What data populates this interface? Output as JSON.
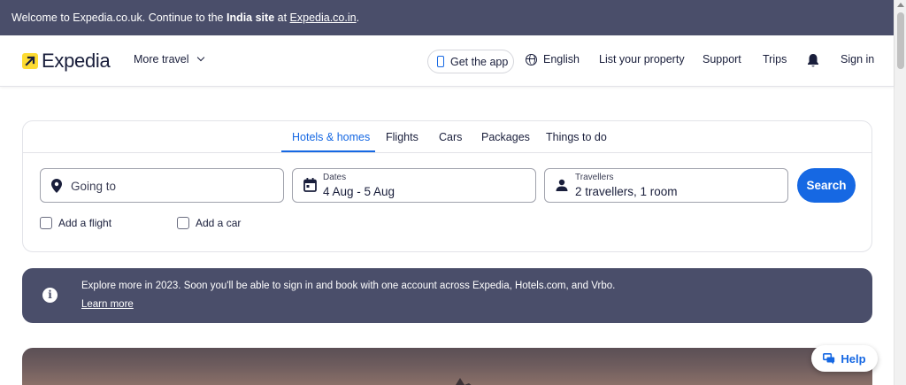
{
  "banner": {
    "prefix": "Welcome to Expedia.co.uk. Continue to the ",
    "bold": "India site",
    "middle": " at ",
    "link": "Expedia.co.in",
    "suffix": "."
  },
  "header": {
    "logo_text": "Expedia",
    "more_travel": "More travel",
    "get_app": "Get the app",
    "language": "English",
    "list_property": "List your property",
    "support": "Support",
    "trips": "Trips",
    "sign_in": "Sign in"
  },
  "search": {
    "tabs": [
      {
        "label": "Hotels & homes",
        "active": true
      },
      {
        "label": "Flights",
        "active": false
      },
      {
        "label": "Cars",
        "active": false
      },
      {
        "label": "Packages",
        "active": false
      },
      {
        "label": "Things to do",
        "active": false
      }
    ],
    "destination_placeholder": "Going to",
    "dates_label": "Dates",
    "dates_value": "4 Aug - 5 Aug",
    "travellers_label": "Travellers",
    "travellers_value": "2 travellers, 1 room",
    "search_button": "Search",
    "add_flight": "Add a flight",
    "add_car": "Add a car"
  },
  "info": {
    "text": "Explore more in 2023. Soon you'll be able to sign in and book with one account across Expedia, Hotels.com, and Vrbo.",
    "link": "Learn more"
  },
  "help": {
    "label": "Help"
  },
  "colors": {
    "brand_blue": "#1668e3",
    "banner_bg": "#4a4e6a",
    "logo_yellow": "#fddb32",
    "text_dark": "#191e3b"
  },
  "icons": [
    "logo-arrow-icon",
    "chevron-down-icon",
    "phone-icon",
    "globe-icon",
    "bell-icon",
    "location-pin-icon",
    "calendar-icon",
    "person-icon",
    "info-icon",
    "chat-icon"
  ]
}
